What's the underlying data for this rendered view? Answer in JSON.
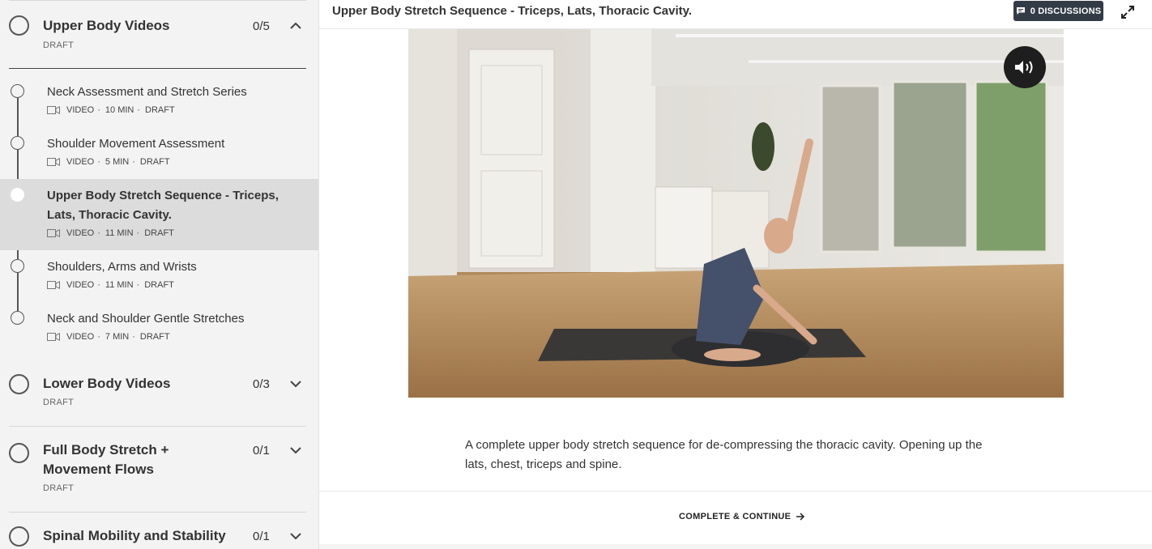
{
  "sidebar": {
    "sections": [
      {
        "title": "Upper Body Videos",
        "status": "DRAFT",
        "count": "0/5",
        "expanded": true
      },
      {
        "title": "Lower Body Videos",
        "status": "DRAFT",
        "count": "0/3",
        "expanded": false
      },
      {
        "title": "Full Body Stretch + Movement Flows",
        "status": "DRAFT",
        "count": "0/1",
        "expanded": false
      },
      {
        "title": "Spinal Mobility and Stability",
        "count": "0/1",
        "expanded": false
      }
    ],
    "lessons": [
      {
        "title": "Neck Assessment and Stretch Series",
        "type": "VIDEO",
        "duration": "10 MIN",
        "status": "DRAFT"
      },
      {
        "title": "Shoulder Movement Assessment",
        "type": "VIDEO",
        "duration": "5 MIN",
        "status": "DRAFT"
      },
      {
        "title": "Upper Body Stretch Sequence - Triceps, Lats, Thoracic Cavity.",
        "type": "VIDEO",
        "duration": "11 MIN",
        "status": "DRAFT",
        "active": true
      },
      {
        "title": "Shoulders, Arms and Wrists",
        "type": "VIDEO",
        "duration": "11 MIN",
        "status": "DRAFT"
      },
      {
        "title": "Neck and Shoulder Gentle Stretches",
        "type": "VIDEO",
        "duration": "7 MIN",
        "status": "DRAFT"
      }
    ]
  },
  "main": {
    "heading": "Upper Body Stretch Sequence - Triceps, Lats, Thoracic Cavity.",
    "discussions_label": "0 DISCUSSIONS",
    "description": "A complete upper body stretch sequence for de-compressing the thoracic cavity. Opening up the lats, chest, triceps and spine.",
    "complete_label": "COMPLETE & CONTINUE"
  },
  "icons": {
    "discussions": "chat-bubble-icon",
    "expand": "expand-icon",
    "volume": "volume-icon",
    "video": "video-camera-icon",
    "section_open": "chevron-up-icon",
    "section_closed": "chevron-down-icon",
    "arrow": "arrow-right-icon"
  },
  "colors": {
    "sidebar_bg": "#f3f3f3",
    "active_lesson_bg": "#dcdcdc",
    "button_dark": "#333b46"
  }
}
